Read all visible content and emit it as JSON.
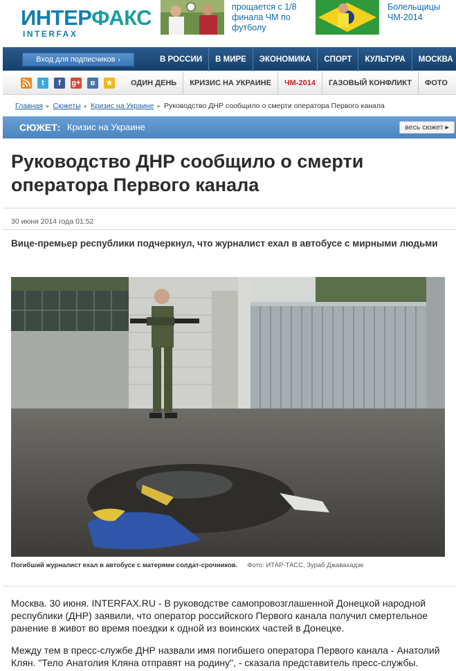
{
  "header": {
    "logo_ru_main": "ИНТЕР",
    "logo_ru_swoosh": "ФАКС",
    "logo_en": "INTERFAX",
    "promos": [
      {
        "text": "прощается с 1/8 финала ЧМ по футболу"
      },
      {
        "text": "Болельщицы ЧМ-2014"
      }
    ]
  },
  "topnav": {
    "login": "Вход для подписчиков",
    "items": [
      "В РОССИИ",
      "В МИРЕ",
      "ЭКОНОМИКА",
      "СПОРТ",
      "КУЛЬТУРА",
      "МОСКВА"
    ]
  },
  "subnav": {
    "social": [
      "rss-icon",
      "twitter-icon",
      "facebook-icon",
      "google-plus-icon",
      "vk-icon",
      "favorites-icon"
    ],
    "items": [
      "ОДИН ДЕНЬ",
      "КРИЗИС НА УКРАИНЕ",
      "ЧМ-2014",
      "ГАЗОВЫЙ КОНФЛИКТ",
      "ФОТО"
    ],
    "highlight_color": "#cc1d1d"
  },
  "breadcrumb": {
    "items": [
      "Главная",
      "Сюжеты",
      "Кризис на Украине"
    ],
    "current": "Руководство ДНР сообщило о смерти оператора Первого канала"
  },
  "story": {
    "label": "СЮЖЕТ",
    "colon": ":",
    "name": "Кризис на Украине",
    "all_button": "весь сюжет ▸"
  },
  "article": {
    "headline": "Руководство ДНР сообщило о смерти оператора Первого канала",
    "date": "30 июня 2014 года 01:52",
    "lead": "Вице-премьер республики подчеркнул, что журналист ехал в автобусе с мирными людьми",
    "caption": "Погибший журналист ехал в автобусе с матерями солдат-срочников.",
    "credit": "Фото: ИТАР-ТАСС, Зураб Джавахадзе",
    "paragraphs": [
      "Москва. 30 июня. INTERFAX.RU - В руководстве самопровозглашенной Донецкой народной республики (ДНР) заявили, что оператор российского Первого канала получил смертельное ранение в живот во время поездки к одной из воинских частей в Донецке.",
      "Между тем в пресс-службе ДНР назвали имя погибшего оператора Первого канала - Анатолий Клян. \"Тело Анатолия Кляна отправят на родину\", - сказала представитель пресс-службы."
    ]
  },
  "colors": {
    "brand": "#0f7fb0",
    "nav_bg": "#1f4d7c",
    "story_bar": "#5a91c9"
  }
}
